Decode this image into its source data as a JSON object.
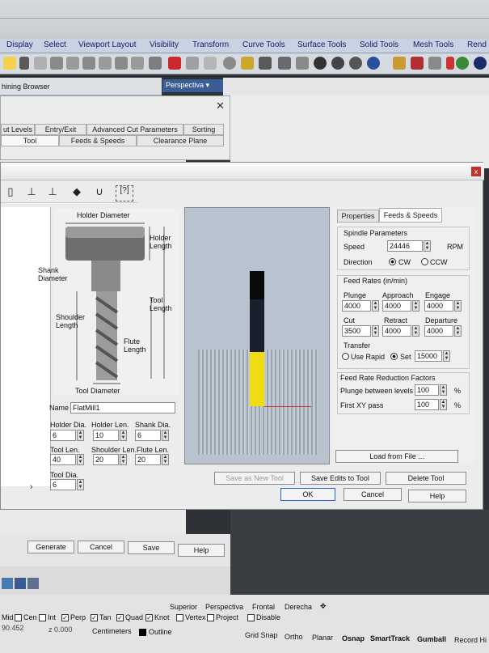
{
  "menubar": {
    "tabs": [
      "Display",
      "Select",
      "Viewport Layout",
      "Visibility",
      "Transform",
      "Curve Tools",
      "Surface Tools",
      "Solid Tools",
      "Mesh Tools",
      "Rend"
    ]
  },
  "browser": {
    "title": "hining Browser",
    "close_label": "✕",
    "viewport_tab": "Perspectiva",
    "tabs_row1": [
      "ut Levels",
      "Entry/Exit",
      "Advanced Cut Parameters",
      "Sorting"
    ],
    "tabs_row2": [
      "Tool",
      "Feeds & Speeds",
      "Clearance Plane"
    ]
  },
  "dialog": {
    "close_label": "x",
    "toolbar_icons": [
      "ball-mill-icon",
      "flat-mill-icon",
      "taper-mill-icon",
      "chamfer-icon",
      "bull-nose-icon",
      "custom-tool-icon"
    ],
    "toolbar_glyphs": [
      "▯",
      "⊥",
      "⊥",
      "◆",
      "∪",
      "[?]"
    ],
    "diagram": {
      "holder_diameter": "Holder Diameter",
      "holder_length": "Holder\nLength",
      "shank_diameter": "Shank\nDiameter",
      "tool_length": "Tool\nLength",
      "shoulder_length": "Shoulder\nLength",
      "flute_length": "Flute\nLength",
      "tool_diameter": "Tool Diameter"
    },
    "name_label": "Name",
    "name_value": "FlatMill1",
    "fields": [
      {
        "label": "Holder Dia.",
        "value": "6"
      },
      {
        "label": "Holder Len.",
        "value": "10"
      },
      {
        "label": "Shank Dia.",
        "value": "6"
      },
      {
        "label": "Tool Len.",
        "value": "40"
      },
      {
        "label": "Shoulder Len.",
        "value": "20"
      },
      {
        "label": "Flute Len.",
        "value": "20"
      },
      {
        "label": "Tool Dia.",
        "value": "6"
      }
    ],
    "tabs": [
      "Properties",
      "Feeds & Speeds"
    ],
    "spindle": {
      "title": "Spindle Parameters",
      "speed_label": "Speed",
      "speed_value": "24446",
      "speed_unit": "RPM",
      "direction_label": "Direction",
      "cw": "CW",
      "ccw": "CCW"
    },
    "feed": {
      "title": "Feed Rates (in/min)",
      "plunge_label": "Plunge",
      "plunge": "4000",
      "approach_label": "Approach",
      "approach": "4000",
      "engage_label": "Engage",
      "engage": "4000",
      "cut_label": "Cut",
      "cut": "3500",
      "retract_label": "Retract",
      "retract": "4000",
      "departure_label": "Departure",
      "departure": "4000",
      "transfer_label": "Transfer",
      "use_rapid": "Use Rapid",
      "set_label": "Set",
      "set_value": "15000"
    },
    "reduction": {
      "title": "Feed Rate Reduction Factors",
      "plunge_between_label": "Plunge between levels",
      "plunge_between": "100",
      "first_xy_label": "First XY pass",
      "first_xy": "100",
      "pct": "%"
    },
    "load_from_file": "Load from File ...",
    "save_as_new": "Save as New Tool",
    "save_edits": "Save Edits to Tool",
    "delete_tool": "Delete Tool",
    "ok": "OK",
    "cancel": "Cancel",
    "help": "Help",
    "arrow": "›"
  },
  "lower_buttons": [
    "Generate",
    "Cancel",
    "Save",
    "Help"
  ],
  "viewport_tabs": [
    "Superior",
    "Perspectiva",
    "Frontal",
    "Derecha",
    "✥"
  ],
  "statusbar": {
    "osnaps": [
      {
        "label": "Mid",
        "checked": false,
        "show_box": false
      },
      {
        "label": "Cen",
        "checked": false,
        "show_box": true
      },
      {
        "label": "Int",
        "checked": false,
        "show_box": true
      },
      {
        "label": "Perp",
        "checked": true,
        "show_box": true
      },
      {
        "label": "Tan",
        "checked": true,
        "show_box": true
      },
      {
        "label": "Quad",
        "checked": true,
        "show_box": true
      },
      {
        "label": "Knot",
        "checked": true,
        "show_box": true
      },
      {
        "label": "Vertex",
        "checked": false,
        "show_box": true
      },
      {
        "label": "Project",
        "checked": false,
        "show_box": true
      },
      {
        "label": "Disable",
        "checked": false,
        "show_box": true
      }
    ],
    "coord_x": "90.452",
    "coord_z": "z 0.000",
    "units": "Centimeters",
    "layer": "Outline",
    "modes": [
      "Grid Snap",
      "Ortho",
      "Planar",
      "Osnap",
      "SmartTrack",
      "Gumball",
      "Record Hi"
    ]
  }
}
